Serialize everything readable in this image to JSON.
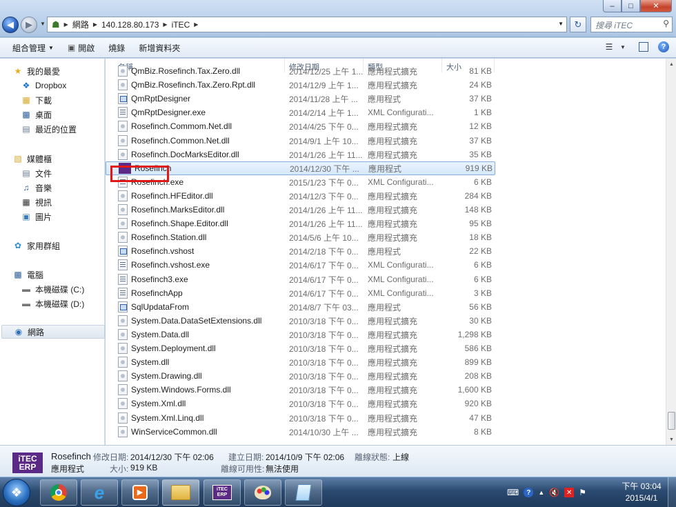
{
  "window": {
    "minimize": "–",
    "maximize": "□",
    "close": "✕"
  },
  "address": {
    "segments": [
      "網路",
      "140.128.80.173",
      "iTEC"
    ]
  },
  "search": {
    "placeholder": "搜尋 iTEC"
  },
  "toolbar": {
    "organize": "組合管理",
    "open": "開啟",
    "burn": "燒錄",
    "new_folder": "新增資料夾"
  },
  "nav": {
    "favorites": "我的最愛",
    "dropbox": "Dropbox",
    "downloads": "下載",
    "desktop": "桌面",
    "recent": "最近的位置",
    "libraries": "媒體櫃",
    "documents": "文件",
    "music": "音樂",
    "videos": "視訊",
    "pictures": "圖片",
    "homegroup": "家用群組",
    "computer": "電腦",
    "disk_c": "本機磁碟 (C:)",
    "disk_d": "本機磁碟 (D:)",
    "network": "網路"
  },
  "columns": {
    "name": "名稱",
    "date": "修改日期",
    "type": "類型",
    "size": "大小"
  },
  "files": [
    {
      "name": "QmBiz.Rosefinch.Tax.Zero.dll",
      "date": "2014/12/25 上午 1...",
      "type": "應用程式擴充",
      "size": "81 KB",
      "icon": "dll"
    },
    {
      "name": "QmBiz.Rosefinch.Tax.Zero.Rpt.dll",
      "date": "2014/12/9 上午 1...",
      "type": "應用程式擴充",
      "size": "24 KB",
      "icon": "dll"
    },
    {
      "name": "QmRptDesigner",
      "date": "2014/11/28 上午 ...",
      "type": "應用程式",
      "size": "37 KB",
      "icon": "exe"
    },
    {
      "name": "QmRptDesigner.exe",
      "date": "2014/2/14 上午 1...",
      "type": "XML Configurati...",
      "size": "1 KB",
      "icon": "cfg"
    },
    {
      "name": "Rosefinch.Commom.Net.dll",
      "date": "2014/4/25 下午 0...",
      "type": "應用程式擴充",
      "size": "12 KB",
      "icon": "dll"
    },
    {
      "name": "Rosefinch.Common.Net.dll",
      "date": "2014/9/1 上午 10...",
      "type": "應用程式擴充",
      "size": "37 KB",
      "icon": "dll"
    },
    {
      "name": "Rosefinch.DocMarksEditor.dll",
      "date": "2014/1/26 上午 11...",
      "type": "應用程式擴充",
      "size": "35 KB",
      "icon": "dll"
    },
    {
      "name": "Rosefinch",
      "date": "2014/12/30 下午 ...",
      "type": "應用程式",
      "size": "919 KB",
      "icon": "itec",
      "selected": true
    },
    {
      "name": "Rosefinch.exe",
      "date": "2015/1/23 下午 0...",
      "type": "XML Configurati...",
      "size": "6 KB",
      "icon": "cfg"
    },
    {
      "name": "Rosefinch.HFEditor.dll",
      "date": "2014/12/3 下午 0...",
      "type": "應用程式擴充",
      "size": "284 KB",
      "icon": "dll"
    },
    {
      "name": "Rosefinch.MarksEditor.dll",
      "date": "2014/1/26 上午 11...",
      "type": "應用程式擴充",
      "size": "148 KB",
      "icon": "dll"
    },
    {
      "name": "Rosefinch.Shape.Editor.dll",
      "date": "2014/1/26 上午 11...",
      "type": "應用程式擴充",
      "size": "95 KB",
      "icon": "dll"
    },
    {
      "name": "Rosefinch.Station.dll",
      "date": "2014/5/6 上午 10...",
      "type": "應用程式擴充",
      "size": "18 KB",
      "icon": "dll"
    },
    {
      "name": "Rosefinch.vshost",
      "date": "2014/2/18 下午 0...",
      "type": "應用程式",
      "size": "22 KB",
      "icon": "exe"
    },
    {
      "name": "Rosefinch.vshost.exe",
      "date": "2014/6/17 下午 0...",
      "type": "XML Configurati...",
      "size": "6 KB",
      "icon": "cfg"
    },
    {
      "name": "Rosefinch3.exe",
      "date": "2014/6/17 下午 0...",
      "type": "XML Configurati...",
      "size": "6 KB",
      "icon": "cfg"
    },
    {
      "name": "RosefinchApp",
      "date": "2014/6/17 下午 0...",
      "type": "XML Configurati...",
      "size": "3 KB",
      "icon": "cfg"
    },
    {
      "name": "SqlUpdataFrom",
      "date": "2014/8/7 下午 03...",
      "type": "應用程式",
      "size": "56 KB",
      "icon": "exe"
    },
    {
      "name": "System.Data.DataSetExtensions.dll",
      "date": "2010/3/18 下午 0...",
      "type": "應用程式擴充",
      "size": "30 KB",
      "icon": "dll"
    },
    {
      "name": "System.Data.dll",
      "date": "2010/3/18 下午 0...",
      "type": "應用程式擴充",
      "size": "1,298 KB",
      "icon": "dll"
    },
    {
      "name": "System.Deployment.dll",
      "date": "2010/3/18 下午 0...",
      "type": "應用程式擴充",
      "size": "586 KB",
      "icon": "dll"
    },
    {
      "name": "System.dll",
      "date": "2010/3/18 下午 0...",
      "type": "應用程式擴充",
      "size": "899 KB",
      "icon": "dll"
    },
    {
      "name": "System.Drawing.dll",
      "date": "2010/3/18 下午 0...",
      "type": "應用程式擴充",
      "size": "208 KB",
      "icon": "dll"
    },
    {
      "name": "System.Windows.Forms.dll",
      "date": "2010/3/18 下午 0...",
      "type": "應用程式擴充",
      "size": "1,600 KB",
      "icon": "dll"
    },
    {
      "name": "System.Xml.dll",
      "date": "2010/3/18 下午 0...",
      "type": "應用程式擴充",
      "size": "920 KB",
      "icon": "dll"
    },
    {
      "name": "System.Xml.Linq.dll",
      "date": "2010/3/18 下午 0...",
      "type": "應用程式擴充",
      "size": "47 KB",
      "icon": "dll"
    },
    {
      "name": "WinServiceCommon.dll",
      "date": "2014/10/30 上午 ...",
      "type": "應用程式擴充",
      "size": "8 KB",
      "icon": "dll"
    }
  ],
  "details": {
    "name": "Rosefinch",
    "type": "應用程式",
    "modified_label": "修改日期:",
    "modified_value": "2014/12/30 下午 02:06",
    "created_label": "建立日期:",
    "created_value": "2014/10/9 下午 02:06",
    "size_label": "大小:",
    "size_value": "919 KB",
    "offline_status_label": "離線狀態:",
    "offline_status_value": "上線",
    "offline_avail_label": "離線可用性:",
    "offline_avail_value": "無法使用",
    "icon_line1": "iTEC",
    "icon_line2": "ERP"
  },
  "taskbar": {
    "itec_line1": "iTEC",
    "itec_line2": "ERP",
    "time": "下午 03:04",
    "date": "2015/4/1"
  }
}
